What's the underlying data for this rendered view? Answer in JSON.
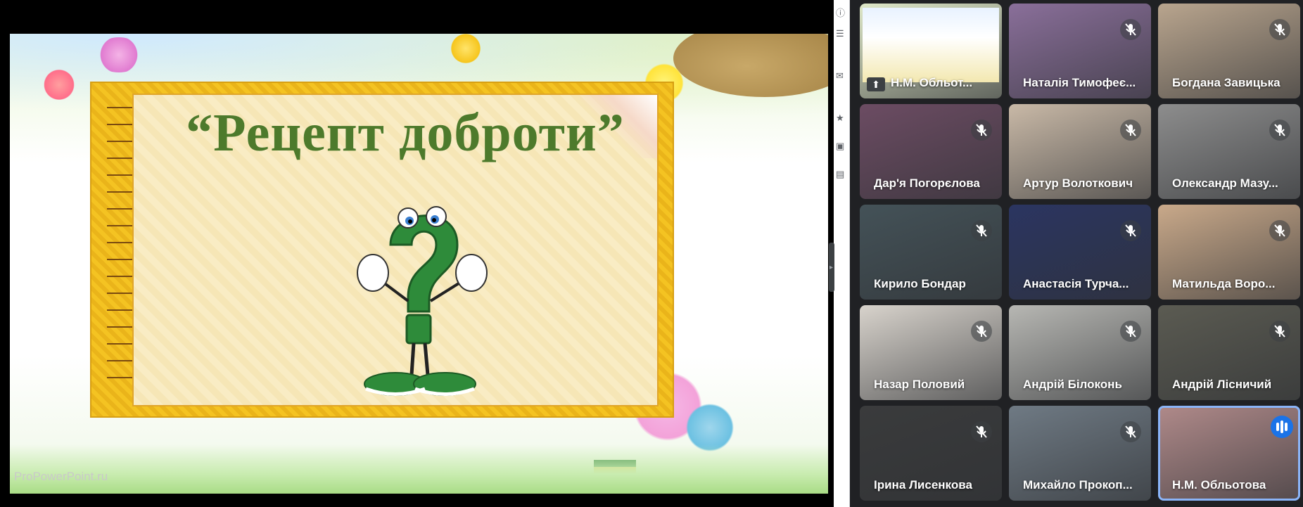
{
  "slide": {
    "title": "“Рецепт доброти”",
    "watermark": "ProPowerPoint.ru",
    "colors": {
      "title": "#4d7a2c",
      "frame": "#f4c322",
      "paper": "#f9ecc4"
    }
  },
  "participants": [
    {
      "name": "Н.М. Обльот...",
      "muted": false,
      "presenting": true,
      "bg": "#dfe8c8"
    },
    {
      "name": "Наталія Тимофеє...",
      "muted": true,
      "bg": "#8a6f9a"
    },
    {
      "name": "Богдана Завицька",
      "muted": true,
      "bg": "#b9a58e"
    },
    {
      "name": "Дар'я Погорєлова",
      "muted": true,
      "bg": "#6c4c63"
    },
    {
      "name": "Артур Волоткович",
      "muted": true,
      "bg": "#c9b9a7"
    },
    {
      "name": "Олександр Мазу...",
      "muted": true,
      "bg": "#8d8d8d"
    },
    {
      "name": "Кирило Бондар",
      "muted": true,
      "bg": "#445258"
    },
    {
      "name": "Анастасія Турча...",
      "muted": true,
      "bg": "#2b3561"
    },
    {
      "name": "Матильда Воро...",
      "muted": true,
      "bg": "#c9a98a"
    },
    {
      "name": "Назар Половий",
      "muted": true,
      "bg": "#d8d3cc"
    },
    {
      "name": "Андрій Білоконь",
      "muted": true,
      "bg": "#b7b7b3"
    },
    {
      "name": "Андрій Лісничий",
      "muted": true,
      "bg": "#5b5b52"
    },
    {
      "name": "Ірина Лисенкова",
      "muted": true,
      "bg": "#3a3b3c"
    },
    {
      "name": "Михайло Прокоп...",
      "muted": true,
      "bg": "#6f7a84"
    },
    {
      "name": "Н.М. Обльотова",
      "muted": false,
      "speaking": true,
      "bg": "#b08a8a"
    }
  ],
  "icons": {
    "mic_off": "mic-off-icon",
    "speaking": "audio-level-icon",
    "present": "present-icon"
  }
}
